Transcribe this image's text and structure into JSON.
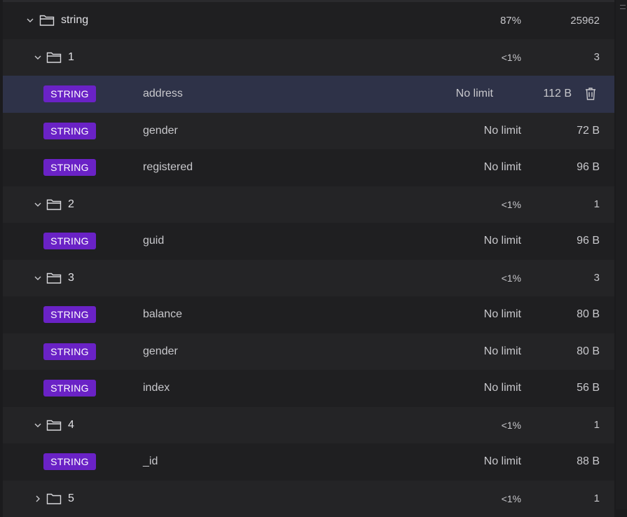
{
  "root": {
    "name": "string",
    "percent": "87%",
    "count": "25962"
  },
  "groups": [
    {
      "name": "1",
      "percent": "<1%",
      "count": "3",
      "keys": [
        {
          "type": "STRING",
          "name": "address",
          "ttl": "No limit",
          "size": "112 B"
        },
        {
          "type": "STRING",
          "name": "gender",
          "ttl": "No limit",
          "size": "72 B"
        },
        {
          "type": "STRING",
          "name": "registered",
          "ttl": "No limit",
          "size": "96 B"
        }
      ]
    },
    {
      "name": "2",
      "percent": "<1%",
      "count": "1",
      "keys": [
        {
          "type": "STRING",
          "name": "guid",
          "ttl": "No limit",
          "size": "96 B"
        }
      ]
    },
    {
      "name": "3",
      "percent": "<1%",
      "count": "3",
      "keys": [
        {
          "type": "STRING",
          "name": "balance",
          "ttl": "No limit",
          "size": "80 B"
        },
        {
          "type": "STRING",
          "name": "gender",
          "ttl": "No limit",
          "size": "80 B"
        },
        {
          "type": "STRING",
          "name": "index",
          "ttl": "No limit",
          "size": "56 B"
        }
      ]
    },
    {
      "name": "4",
      "percent": "<1%",
      "count": "1",
      "keys": [
        {
          "type": "STRING",
          "name": "_id",
          "ttl": "No limit",
          "size": "88 B"
        }
      ]
    },
    {
      "name": "5",
      "percent": "<1%",
      "count": "1",
      "collapsed": true
    }
  ],
  "icons": {
    "expanded": "chevron-down-icon",
    "collapsed": "chevron-right-icon",
    "folder": "folder-icon",
    "delete": "trash-icon"
  },
  "colors": {
    "badge_bg": "#6a22c6",
    "selected_row": "#2e3248",
    "background": "#1b1b1d"
  }
}
